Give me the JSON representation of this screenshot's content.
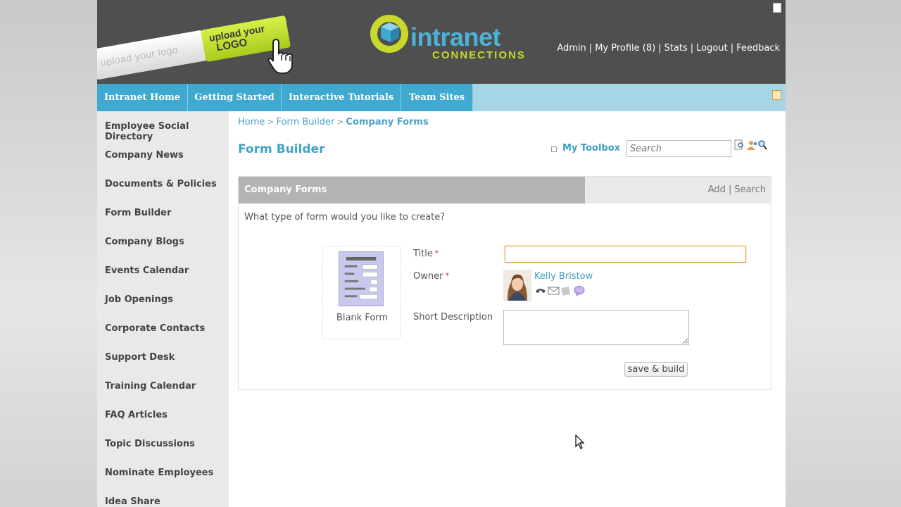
{
  "header": {
    "upload_logo_white": "upload your logo",
    "upload_logo_green_line1": "upload your",
    "upload_logo_green_line2": "LOGO",
    "brand_intranet": "intranet",
    "brand_connections": "CONNECTIONS",
    "top_links": [
      "Admin",
      "My Profile (8)",
      "Stats",
      "Logout",
      "Feedback"
    ],
    "link_separator": "|"
  },
  "nav": {
    "tabs": [
      "Intranet Home",
      "Getting Started",
      "Interactive Tutorials",
      "Team Sites"
    ]
  },
  "sidebar": {
    "items": [
      "Employee Social Directory",
      "Company News",
      "Documents & Policies",
      "Form Builder",
      "Company Blogs",
      "Events Calendar",
      "Job Openings",
      "Corporate Contacts",
      "Support Desk",
      "Training Calendar",
      "FAQ Articles",
      "Topic Discussions",
      "Nominate Employees",
      "Idea Share"
    ]
  },
  "breadcrumb": {
    "items": [
      "Home",
      "Form Builder",
      "Company Forms"
    ],
    "separator": ">"
  },
  "page": {
    "title": "Form Builder",
    "toolbox_label": "My Toolbox",
    "search_placeholder": "Search"
  },
  "panel": {
    "title": "Company Forms",
    "actions": [
      "Add",
      "Search"
    ],
    "action_separator": "|",
    "question": "What type of form would you like to create?",
    "template_label": "Blank Form",
    "fields": {
      "title_label": "Title",
      "owner_label": "Owner",
      "required_mark": "*",
      "owner_name": "Kelly Bristow",
      "description_label": "Short Description",
      "title_value": "",
      "description_value": ""
    },
    "save_button": "save & build"
  },
  "colors": {
    "header_bg": "#4f4f4f",
    "nav_tab": "#3fa9cf",
    "nav_bar": "#a6d5e6",
    "accent_blue": "#3fa3c7",
    "brand_green": "#c8d82c",
    "sidebar_bg": "#e9e9e9",
    "panel_header": "#b3b3b3"
  }
}
